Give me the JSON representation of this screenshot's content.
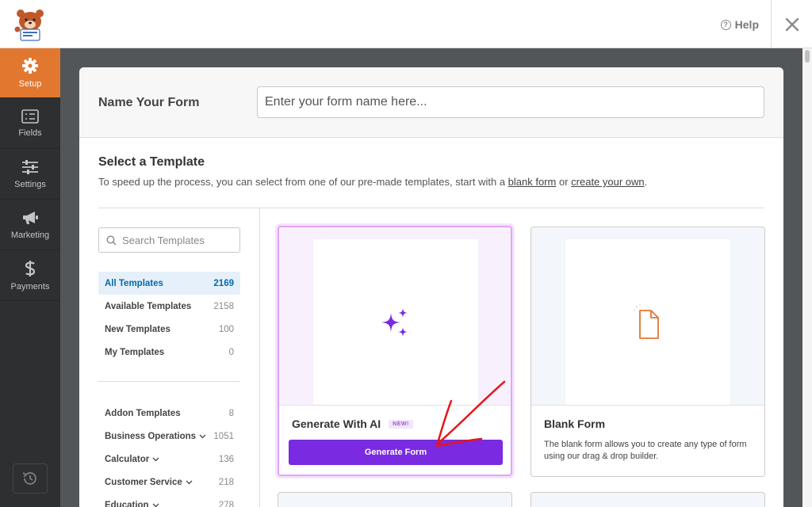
{
  "topbar": {
    "help_label": "Help"
  },
  "sidebar": {
    "items": [
      {
        "label": "Setup",
        "icon": "gear-icon"
      },
      {
        "label": "Fields",
        "icon": "list-icon"
      },
      {
        "label": "Settings",
        "icon": "sliders-icon"
      },
      {
        "label": "Marketing",
        "icon": "megaphone-icon"
      },
      {
        "label": "Payments",
        "icon": "dollar-icon"
      }
    ]
  },
  "form": {
    "name_label": "Name Your Form",
    "name_placeholder": "Enter your form name here..."
  },
  "templates": {
    "title": "Select a Template",
    "desc_prefix": "To speed up the process, you can select from one of our pre-made templates, start with a ",
    "link_blank": "blank form",
    "desc_or": " or ",
    "link_create": "create your own",
    "desc_suffix": ".",
    "search_placeholder": "Search Templates",
    "categories": [
      {
        "label": "All Templates",
        "count": "2169"
      },
      {
        "label": "Available Templates",
        "count": "2158"
      },
      {
        "label": "New Templates",
        "count": "100"
      },
      {
        "label": "My Templates",
        "count": "0"
      }
    ],
    "categories2": [
      {
        "label": "Addon Templates",
        "count": "8"
      },
      {
        "label": "Business Operations",
        "count": "1051"
      },
      {
        "label": "Calculator",
        "count": "136"
      },
      {
        "label": "Customer Service",
        "count": "218"
      },
      {
        "label": "Education",
        "count": "278"
      }
    ]
  },
  "cards": {
    "ai": {
      "title": "Generate With AI",
      "badge": "NEW!",
      "button": "Generate Form"
    },
    "blank": {
      "title": "Blank Form",
      "desc": "The blank form allows you to create any type of form using our drag & drop builder."
    }
  },
  "colors": {
    "accent": "#e27730",
    "ai_purple": "#7a2ae0",
    "link_blue": "#036aab",
    "annotation": "#e8141c"
  }
}
